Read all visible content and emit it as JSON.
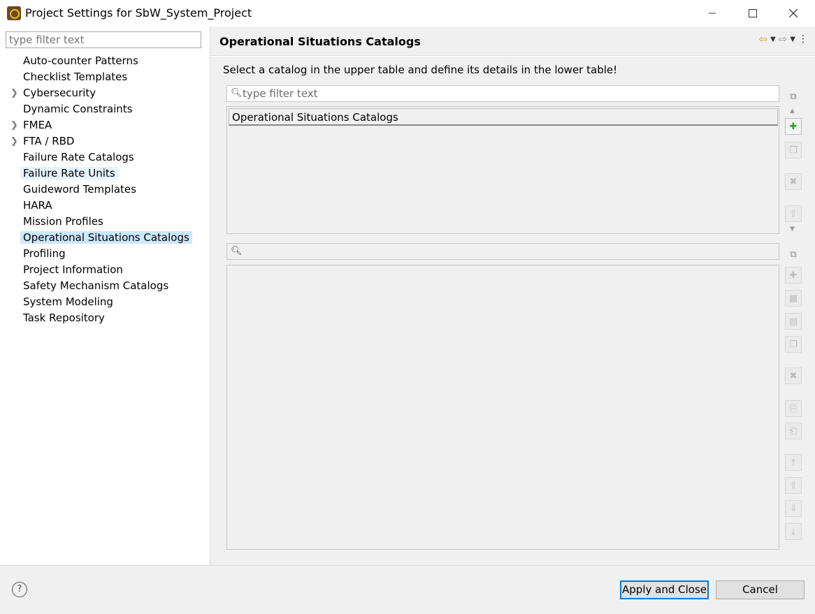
{
  "window": {
    "title": "Project Settings for SbW_System_Project",
    "app_icon": "app-icon"
  },
  "sidebar": {
    "filter_placeholder": "type filter text",
    "items": [
      {
        "label": "Auto-counter Patterns",
        "expandable": false
      },
      {
        "label": "Checklist Templates",
        "expandable": false
      },
      {
        "label": "Cybersecurity",
        "expandable": true
      },
      {
        "label": "Dynamic Constraints",
        "expandable": false
      },
      {
        "label": "FMEA",
        "expandable": true
      },
      {
        "label": "FTA / RBD",
        "expandable": true
      },
      {
        "label": "Failure Rate Catalogs",
        "expandable": false
      },
      {
        "label": "Failure Rate Units",
        "expandable": false,
        "state": "hover"
      },
      {
        "label": "Guideword Templates",
        "expandable": false
      },
      {
        "label": "HARA",
        "expandable": false
      },
      {
        "label": "Mission Profiles",
        "expandable": false
      },
      {
        "label": "Operational Situations Catalogs",
        "expandable": false,
        "state": "selected"
      },
      {
        "label": "Profiling",
        "expandable": false
      },
      {
        "label": "Project Information",
        "expandable": false
      },
      {
        "label": "Safety Mechanism Catalogs",
        "expandable": false
      },
      {
        "label": "System Modeling",
        "expandable": false
      },
      {
        "label": "Task Repository",
        "expandable": false
      }
    ]
  },
  "main": {
    "title": "Operational Situations Catalogs",
    "description": "Select a catalog in the upper table and define its details in the lower table!",
    "upper": {
      "filter_placeholder": "type filter text",
      "column_header": "Operational Situations Catalogs"
    },
    "lower": {
      "filter_placeholder": ""
    }
  },
  "footer": {
    "apply_label": "Apply and Close",
    "cancel_label": "Cancel"
  },
  "colors": {
    "selected_bg": "#cce8ff",
    "hover_bg": "#e5f3ff",
    "accent": "#0078d7",
    "add_green": "#2a9d2a"
  }
}
